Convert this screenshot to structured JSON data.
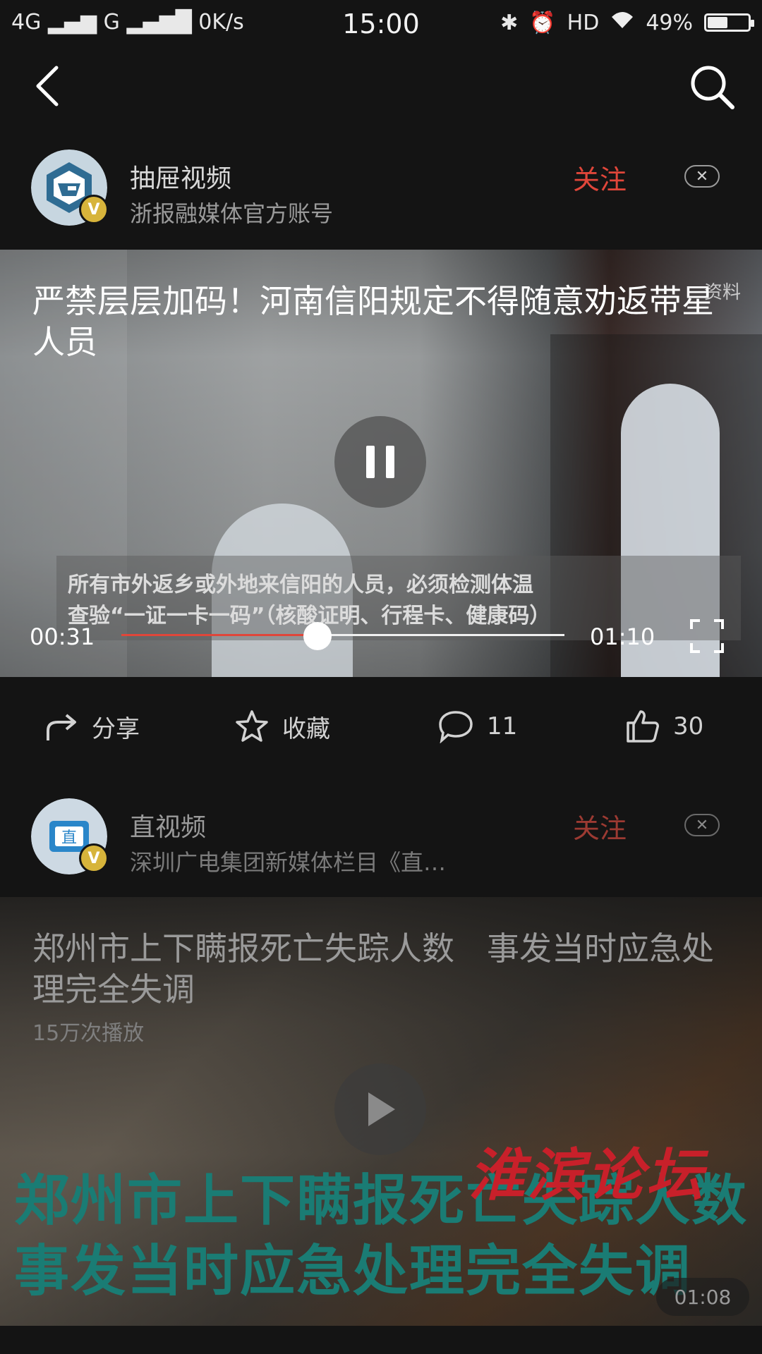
{
  "status_bar": {
    "network_left": "4G",
    "network_mid": "G",
    "speed": "0K/s",
    "time": "15:00",
    "hd": "HD",
    "battery": "49%"
  },
  "nav": {
    "back_icon": "back-arrow-icon",
    "search_icon": "search-icon"
  },
  "feed": [
    {
      "account_name": "抽屉视频",
      "account_desc": "浙报融媒体官方账号",
      "follow_label": "关注",
      "close_label": "✕",
      "video_title": "严禁层层加码！河南信阳规定不得随意劝返带星人员",
      "watermark": "资料",
      "subtitle_line1": "所有市外返乡或外地来信阳的人员，必须检测体温",
      "subtitle_line2": "查验“一证一卡一码”（核酸证明、行程卡、健康码）",
      "current_time": "00:31",
      "total_time": "01:10",
      "progress_fraction": 0.443,
      "actions": {
        "share": "分享",
        "favorite": "收藏",
        "comments": "11",
        "likes": "30"
      }
    },
    {
      "account_name": "直视频",
      "account_desc": "深圳广电集团新媒体栏目《直…",
      "follow_label": "关注",
      "close_label": "✕",
      "video_title": "郑州市上下瞒报死亡失踪人数　事发当时应急处理完全失调",
      "plays": "15万次播放",
      "caption_line1": "郑州市上下瞒报死亡失踪人数",
      "caption_line2": "事发当时应急处理完全失调",
      "logo_watermark": "淮滨论坛",
      "duration": "01:08"
    }
  ],
  "colors": {
    "accent": "#e0463a",
    "background": "#141414",
    "badge": "#d7b43b"
  }
}
